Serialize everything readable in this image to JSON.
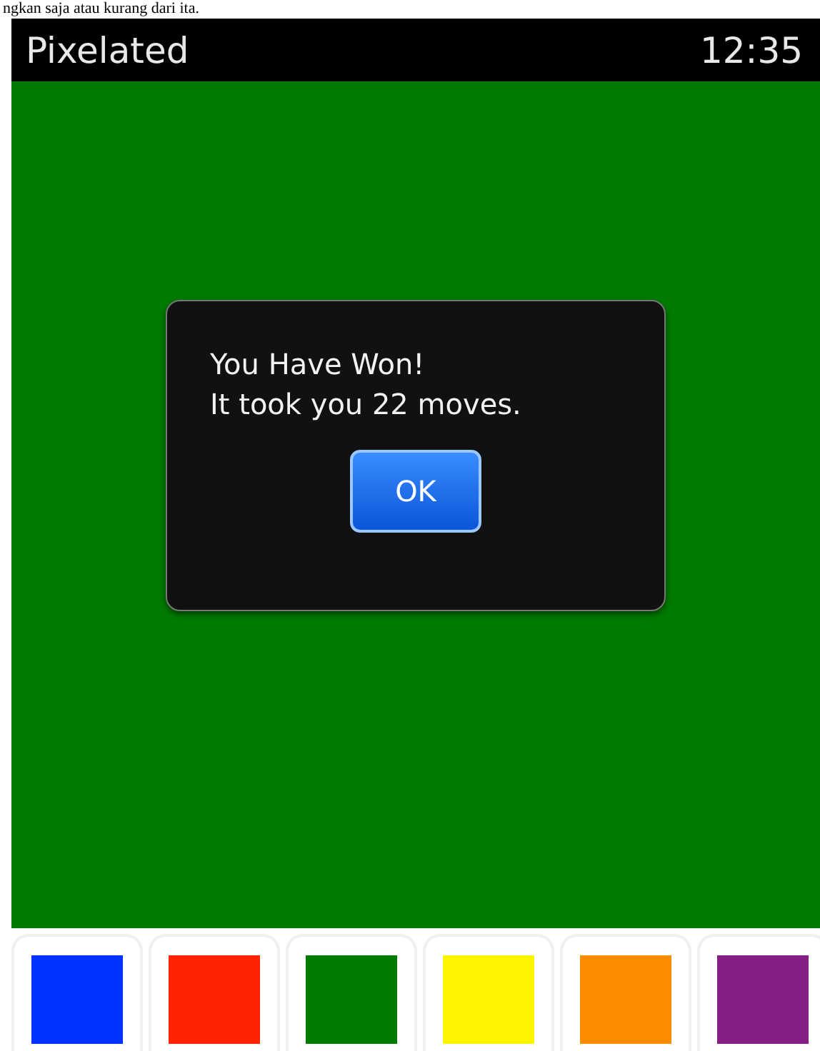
{
  "page_text": "ngkan saja atau kurang dari ita.",
  "status_bar": {
    "title": "Pixelated",
    "time": "12:35"
  },
  "board": {
    "color": "#007b00"
  },
  "dialog": {
    "lines": [
      "You Have Won!",
      "It took you 22 moves."
    ],
    "button": "OK"
  },
  "palette": [
    {
      "color": "#0033ff"
    },
    {
      "color": "#ff2200"
    },
    {
      "color": "#007b00"
    },
    {
      "color": "#fff500"
    },
    {
      "color": "#ff8c00"
    },
    {
      "color": "#861f83"
    }
  ]
}
